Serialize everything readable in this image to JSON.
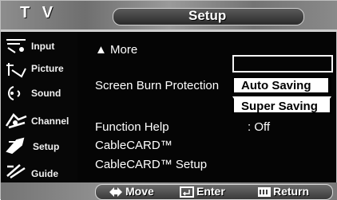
{
  "header": {
    "title": "T V",
    "menu_title": "Setup"
  },
  "sidebar": {
    "items": [
      {
        "label": "Input",
        "icon": "input-icon"
      },
      {
        "label": "Picture",
        "icon": "picture-icon"
      },
      {
        "label": "Sound",
        "icon": "sound-icon"
      },
      {
        "label": "Channel",
        "icon": "channel-icon"
      },
      {
        "label": "Setup",
        "icon": "setup-icon"
      },
      {
        "label": "Guide",
        "icon": "guide-icon"
      }
    ]
  },
  "main": {
    "more_label": "▲ More",
    "rows": [
      {
        "label": "Screen Burn Protection",
        "value": ""
      },
      {
        "label": "Function Help",
        "value": ": Off"
      },
      {
        "label": "CableCARD™",
        "value": ""
      },
      {
        "label": "CableCARD™ Setup",
        "value": ""
      }
    ],
    "dropdown": {
      "options": [
        "Auto Saving",
        "Super Saving"
      ]
    }
  },
  "footer": {
    "hints": [
      {
        "label": "Move",
        "icon": "move-icon"
      },
      {
        "label": "Enter",
        "icon": "enter-icon"
      },
      {
        "label": "Return",
        "icon": "return-icon"
      }
    ]
  },
  "colors": {
    "background": "#050505",
    "text": "#ffffff",
    "bar": "#8a8a8a",
    "option_bg": "#ffffff"
  }
}
